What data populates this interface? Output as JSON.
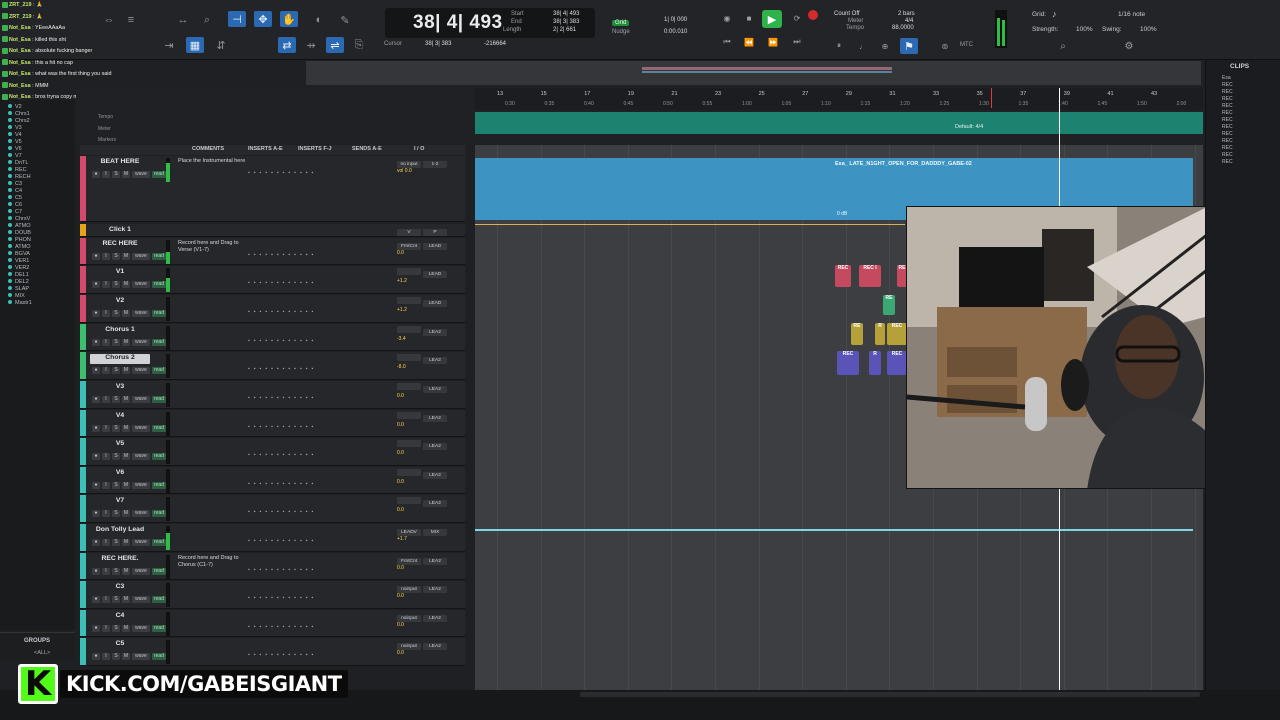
{
  "chat": [
    {
      "user": "ZRT_219",
      "msg": "🙏"
    },
    {
      "user": "ZRT_219",
      "msg": "🙏"
    },
    {
      "user": "Not_Esa",
      "msg": "YEeeAAaAa"
    },
    {
      "user": "Not_Esa",
      "msg": "killed this sht"
    },
    {
      "user": "Not_Esa",
      "msg": "absolute fucking banger"
    },
    {
      "user": "Not_Esa",
      "msg": "this a hit no cap"
    },
    {
      "user": "Not_Esa",
      "msg": "what was the first thing you said"
    },
    {
      "user": "Not_Esa",
      "msg": "MMM"
    },
    {
      "user": "Not_Esa",
      "msg": "bros tryna copy me"
    }
  ],
  "counter": {
    "main": "38| 4| 493",
    "start_label": "Start",
    "end_label": "End",
    "length_label": "Length",
    "start": "38| 4| 493",
    "end": "38| 3| 383",
    "length": "2| 2| 661",
    "cursor_label": "Cursor",
    "cursor": "38| 3| 383",
    "cursor_samples": "-216664",
    "grid_label": "Grid",
    "nudge_label": "Nudge",
    "grid_val": "1| 0| 000",
    "nudge_val": "0:00.010"
  },
  "count": {
    "count_off": "Count Off",
    "meter": "Meter",
    "tempo": "Tempo",
    "bars": "2 bars",
    "meter_val": "4/4",
    "tempo_val": "88.0000"
  },
  "grid_panel": {
    "grid": "Grid:",
    "grid_val": "1/16 note",
    "strength": "Strength:",
    "strength_val": "100%",
    "swing": "Swing:",
    "swing_val": "100%"
  },
  "mtc": "MTC",
  "ruler": {
    "bars": [
      "13",
      "15",
      "17",
      "19",
      "21",
      "23",
      "25",
      "27",
      "29",
      "31",
      "33",
      "35",
      "37",
      "39",
      "41",
      "43"
    ],
    "times": [
      "0:30",
      "0:35",
      "0:40",
      "0:45",
      "0:50",
      "0:55",
      "1:00",
      "1:05",
      "1:10",
      "1:15",
      "1:20",
      "1:25",
      "1:30",
      "1:35",
      "1:40",
      "1:45",
      "1:50",
      "2:00"
    ],
    "meter_default": "Default: 4/4",
    "lane_labels": [
      "Tempo",
      "Meter",
      "Markers"
    ]
  },
  "columns": {
    "comments": "COMMENTS",
    "inserts_ae": "INSERTS A-E",
    "inserts_fj": "INSERTS F-J",
    "sends_ae": "SENDS A-E",
    "io": "I / O"
  },
  "tracks": [
    {
      "name": "BEAT HERE",
      "color": "#d54a6a",
      "comment": "Place the Instrumental here",
      "io": [
        "no input",
        "1-2"
      ],
      "vol": "vol 0.0",
      "meter": 0.8
    },
    {
      "name": "Click 1",
      "color": "#e6a41e",
      "comment": "",
      "io": [
        "V",
        "P"
      ],
      "vol": "",
      "meter": 0
    },
    {
      "name": "REC HERE",
      "color": "#d54a6a",
      "comment": "Record here and Drag to Verse (V1-7)",
      "io": [
        "FrntCnt",
        "LEAD"
      ],
      "vol": "0.0",
      "meter": 0.5
    },
    {
      "name": "V1",
      "color": "#d54a6a",
      "comment": "",
      "io": [
        "",
        "LEAD"
      ],
      "vol": "+1.2",
      "meter": 0.6
    },
    {
      "name": "V2",
      "color": "#d54a6a",
      "comment": "",
      "io": [
        "",
        "LEAD"
      ],
      "vol": "+1.2",
      "meter": 0
    },
    {
      "name": "Chorus 1",
      "color": "#3cbf6e",
      "comment": "",
      "io": [
        "",
        "LEA2"
      ],
      "vol": "-3.4",
      "meter": 0
    },
    {
      "name": "Chorus 2",
      "color": "#3cbf6e",
      "comment": "",
      "io": [
        "",
        "LEA2"
      ],
      "vol": "-8.0",
      "meter": 0
    },
    {
      "name": "V3",
      "color": "#3ac0b8",
      "comment": "",
      "io": [
        "",
        "LEA2"
      ],
      "vol": "0.0",
      "meter": 0
    },
    {
      "name": "V4",
      "color": "#3ac0b8",
      "comment": "",
      "io": [
        "",
        "LEA2"
      ],
      "vol": "0.0",
      "meter": 0
    },
    {
      "name": "V5",
      "color": "#3ac0b8",
      "comment": "",
      "io": [
        "",
        "LEA2"
      ],
      "vol": "0.0",
      "meter": 0
    },
    {
      "name": "V6",
      "color": "#3ac0b8",
      "comment": "",
      "io": [
        "",
        "LEA2"
      ],
      "vol": "0.0",
      "meter": 0
    },
    {
      "name": "V7",
      "color": "#3ac0b8",
      "comment": "",
      "io": [
        "",
        "LEA2"
      ],
      "vol": "0.0",
      "meter": 0
    },
    {
      "name": "Don Tolly Lead",
      "color": "#3ac0b8",
      "comment": "",
      "io": [
        "LEADV",
        "MIX"
      ],
      "vol": "+1.7",
      "meter": 0.7
    },
    {
      "name": "REC HERE.",
      "color": "#3ac0b8",
      "comment": "Record here and Drag to Chorus (C1-7)",
      "io": [
        "FrntCnt",
        "LEA2"
      ],
      "vol": "0.0",
      "meter": 0
    },
    {
      "name": "C3",
      "color": "#3ac0b8",
      "comment": "",
      "io": [
        "noinput",
        "LEA2"
      ],
      "vol": "0.0",
      "meter": 0
    },
    {
      "name": "C4",
      "color": "#3ac0b8",
      "comment": "",
      "io": [
        "noinput",
        "LEA2"
      ],
      "vol": "0.0",
      "meter": 0
    },
    {
      "name": "C5",
      "color": "#3ac0b8",
      "comment": "",
      "io": [
        "noinput",
        "LEA2"
      ],
      "vol": "0.0",
      "meter": 0
    }
  ],
  "tracklist": [
    "V2",
    "Chrs1",
    "Chrs2",
    "V3",
    "V4",
    "V5",
    "V6",
    "V7",
    "DnTL",
    "REC",
    "RECH",
    "C3",
    "C4",
    "C5",
    "C6",
    "C7",
    "ChrsV",
    "ATMO",
    "DOUB",
    "PHON",
    "ATMO",
    "BGVA",
    "VER1",
    "VER2",
    "DEL1",
    "DEL2",
    "SLAP",
    "MIX",
    "Mastr1"
  ],
  "beat_clip": {
    "name": "Esa_ LATE_N1GHT_OPEN_FOR_DADDDY_GABE-02",
    "gain": "0 dB"
  },
  "groups": {
    "title": "GROUPS",
    "all": "<ALL>"
  },
  "clips_panel": {
    "title": "CLIPS",
    "items": [
      "Esa",
      "REC",
      "REC",
      "REC",
      "REC",
      "REC",
      "REC",
      "REC",
      "REC",
      "REC",
      "REC",
      "REC",
      "REC"
    ]
  },
  "kick": {
    "text": "KICK.COM/GABEISGIANT"
  },
  "colors": {
    "accent": "#2c69b3",
    "play": "#2db34a",
    "record": "#d22c2c",
    "tempo_lane": "#1e8270",
    "beat_clip": "#3d93c2",
    "kick_green": "#53fc18"
  }
}
